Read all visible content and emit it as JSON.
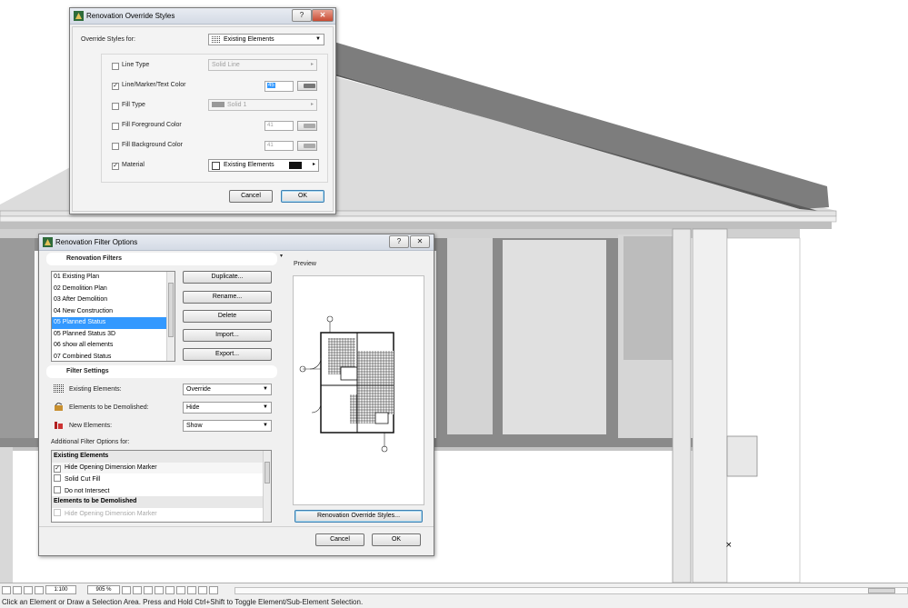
{
  "override_dialog": {
    "title": "Renovation Override Styles",
    "help_label": "?",
    "close_label": "✕",
    "override_for_label": "Override Styles for:",
    "override_for_value": "Existing Elements",
    "rows": [
      {
        "label": "Line Type",
        "checked": false,
        "value": "Solid Line"
      },
      {
        "label": "Line/Marker/Text Color",
        "checked": true,
        "value": "45"
      },
      {
        "label": "Fill Type",
        "checked": false,
        "value": "Solid 1"
      },
      {
        "label": "Fill Foreground Color",
        "checked": false,
        "value": "41"
      },
      {
        "label": "Fill Background Color",
        "checked": false,
        "value": "41"
      },
      {
        "label": "Material",
        "checked": true,
        "value": "Existing Elements"
      }
    ],
    "cancel_label": "Cancel",
    "ok_label": "OK"
  },
  "filter_dialog": {
    "title": "Renovation Filter Options",
    "help_label": "?",
    "close_label": "✕",
    "filters_heading": "Renovation Filters",
    "filters": [
      {
        "label": "01 Existing Plan",
        "selected": false
      },
      {
        "label": "02 Demolition Plan",
        "selected": false
      },
      {
        "label": "03 After Demolition",
        "selected": false
      },
      {
        "label": "04 New Construction",
        "selected": false
      },
      {
        "label": "05 Planned Status",
        "selected": true
      },
      {
        "label": "05 Planned Status 3D",
        "selected": false
      },
      {
        "label": "06 show all elements",
        "selected": false
      },
      {
        "label": "07 Combined Status",
        "selected": false
      }
    ],
    "buttons": {
      "duplicate": "Duplicate...",
      "rename": "Rename...",
      "delete": "Delete",
      "import": "Import...",
      "export": "Export..."
    },
    "settings_heading": "Filter Settings",
    "settings": [
      {
        "label": "Existing Elements:",
        "value": "Override"
      },
      {
        "label": "Elements to be Demolished:",
        "value": "Hide"
      },
      {
        "label": "New Elements:",
        "value": "Show"
      }
    ],
    "additional_label": "Additional Filter Options for:",
    "options": [
      {
        "label": "Existing Elements",
        "kind": "group"
      },
      {
        "label": "Hide Opening Dimension Marker",
        "kind": "check",
        "checked": true,
        "disabled": false
      },
      {
        "label": "Solid Cut Fill",
        "kind": "check",
        "checked": false,
        "disabled": false
      },
      {
        "label": "Do not Intersect",
        "kind": "check",
        "checked": false,
        "disabled": false
      },
      {
        "label": "Elements to be Demolished",
        "kind": "group"
      },
      {
        "label": "Hide Opening Dimension Marker",
        "kind": "check",
        "checked": false,
        "disabled": true
      }
    ],
    "preview_label": "Preview",
    "override_styles_button": "Renovation Override Styles...",
    "cancel_label": "Cancel",
    "ok_label": "OK"
  },
  "statusbar": {
    "scale": "1:100",
    "zoom": "905 %",
    "message": "Click an Element or Draw a Selection Area. Press and Hold Ctrl+Shift to Toggle Element/Sub-Element Selection."
  },
  "colors": {
    "selection": "#3399ff",
    "roof": "#7d7d7d",
    "wall": "#d9d9d9",
    "frame": "#8a8a8a"
  }
}
